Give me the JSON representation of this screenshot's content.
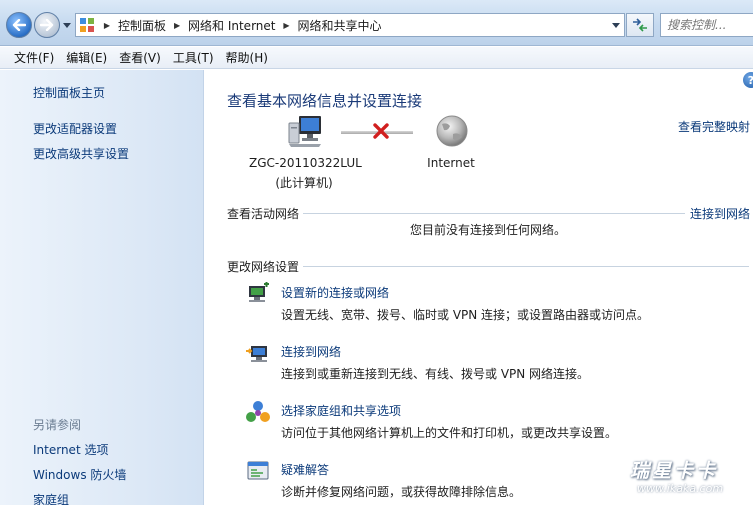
{
  "addressbar": {
    "breadcrumbs": [
      "控制面板",
      "网络和 Internet",
      "网络和共享中心"
    ],
    "search_placeholder": "搜索控制..."
  },
  "menubar": {
    "items": [
      "文件(F)",
      "编辑(E)",
      "查看(V)",
      "工具(T)",
      "帮助(H)"
    ]
  },
  "sidebar": {
    "home": "控制面板主页",
    "links": [
      "更改适配器设置",
      "更改高级共享设置"
    ],
    "see_also_title": "另请参阅",
    "see_also": [
      "Internet 选项",
      "Windows 防火墙",
      "家庭组"
    ]
  },
  "main": {
    "title": "查看基本网络信息并设置连接",
    "full_map": "查看完整映射",
    "computer_name": "ZGC-20110322LUL",
    "computer_sub": "(此计算机)",
    "internet_label": "Internet",
    "active_networks_heading": "查看活动网络",
    "connect_link": "连接到网络",
    "no_connection": "您目前没有连接到任何网络。",
    "change_settings_heading": "更改网络设置",
    "tasks": [
      {
        "link": "设置新的连接或网络",
        "desc": "设置无线、宽带、拨号、临时或 VPN 连接；或设置路由器或访问点。",
        "icon": "new-connection-icon"
      },
      {
        "link": "连接到网络",
        "desc": "连接到或重新连接到无线、有线、拨号或 VPN 网络连接。",
        "icon": "connect-network-icon"
      },
      {
        "link": "选择家庭组和共享选项",
        "desc": "访问位于其他网络计算机上的文件和打印机，或更改共享设置。",
        "icon": "homegroup-icon"
      },
      {
        "link": "疑难解答",
        "desc": "诊断并修复网络问题，或获得故障排除信息。",
        "icon": "troubleshoot-icon"
      }
    ]
  },
  "watermark": {
    "brand": "瑞星卡卡",
    "url": "www.ikaka.com"
  }
}
